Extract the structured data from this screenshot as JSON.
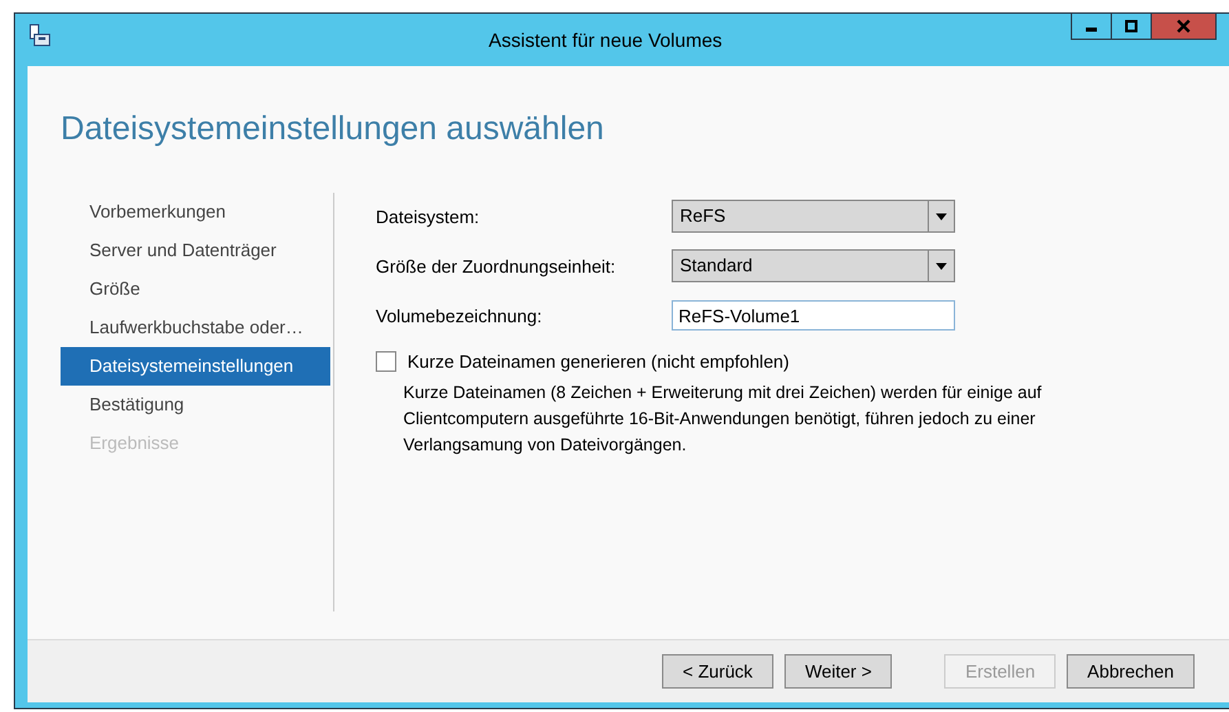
{
  "window": {
    "title": "Assistent für neue Volumes"
  },
  "heading": "Dateisystemeinstellungen auswählen",
  "steps": [
    {
      "label": "Vorbemerkungen",
      "selected": false,
      "disabled": false
    },
    {
      "label": "Server und Datenträger",
      "selected": false,
      "disabled": false
    },
    {
      "label": "Größe",
      "selected": false,
      "disabled": false
    },
    {
      "label": "Laufwerkbuchstabe oder…",
      "selected": false,
      "disabled": false
    },
    {
      "label": "Dateisystemeinstellungen",
      "selected": true,
      "disabled": false
    },
    {
      "label": "Bestätigung",
      "selected": false,
      "disabled": false
    },
    {
      "label": "Ergebnisse",
      "selected": false,
      "disabled": true
    }
  ],
  "fields": [
    {
      "kind": "dropdown",
      "label": "Dateisystem:",
      "value": "ReFS"
    },
    {
      "kind": "dropdown",
      "label": "Größe der Zuordnungseinheit:",
      "value": "Standard"
    },
    {
      "kind": "text",
      "label": "Volumebezeichnung:",
      "value": "ReFS-Volume1"
    }
  ],
  "short_names": {
    "label": "Kurze Dateinamen generieren (nicht empfohlen)",
    "checked": false,
    "description": "Kurze Dateinamen (8 Zeichen + Erweiterung mit drei Zeichen) werden für einige auf Clientcomputern ausgeführte 16-Bit-Anwendungen benötigt, führen jedoch zu einer Verlangsamung von Dateivorgängen."
  },
  "buttons": [
    {
      "label": "< Zurück",
      "disabled": false
    },
    {
      "label": "Weiter >",
      "disabled": false
    },
    {
      "label": "Erstellen",
      "disabled": true
    },
    {
      "label": "Abbrechen",
      "disabled": false
    }
  ]
}
